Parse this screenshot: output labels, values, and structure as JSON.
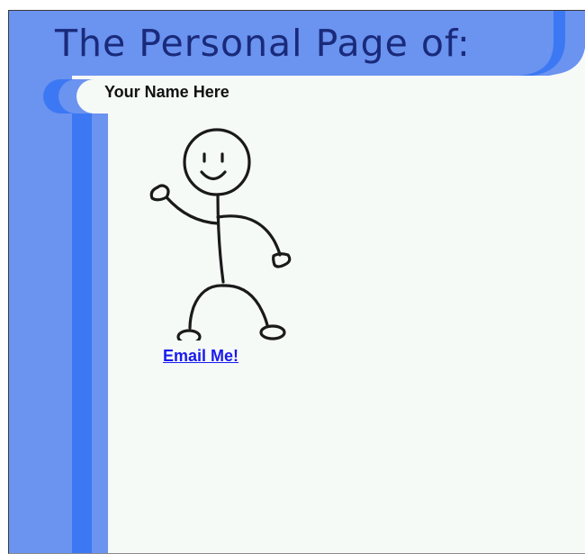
{
  "header": {
    "title": "The Personal Page of:"
  },
  "profile": {
    "name": "Your Name Here",
    "avatar_icon": "stick-figure-waving-icon"
  },
  "links": {
    "email_label": "Email Me!"
  },
  "colors": {
    "light_blue": "#6b93f0",
    "mid_blue": "#3d78f4",
    "title_text": "#1a2a7a",
    "content_bg": "#f6faf7",
    "link": "#1a1aee"
  }
}
